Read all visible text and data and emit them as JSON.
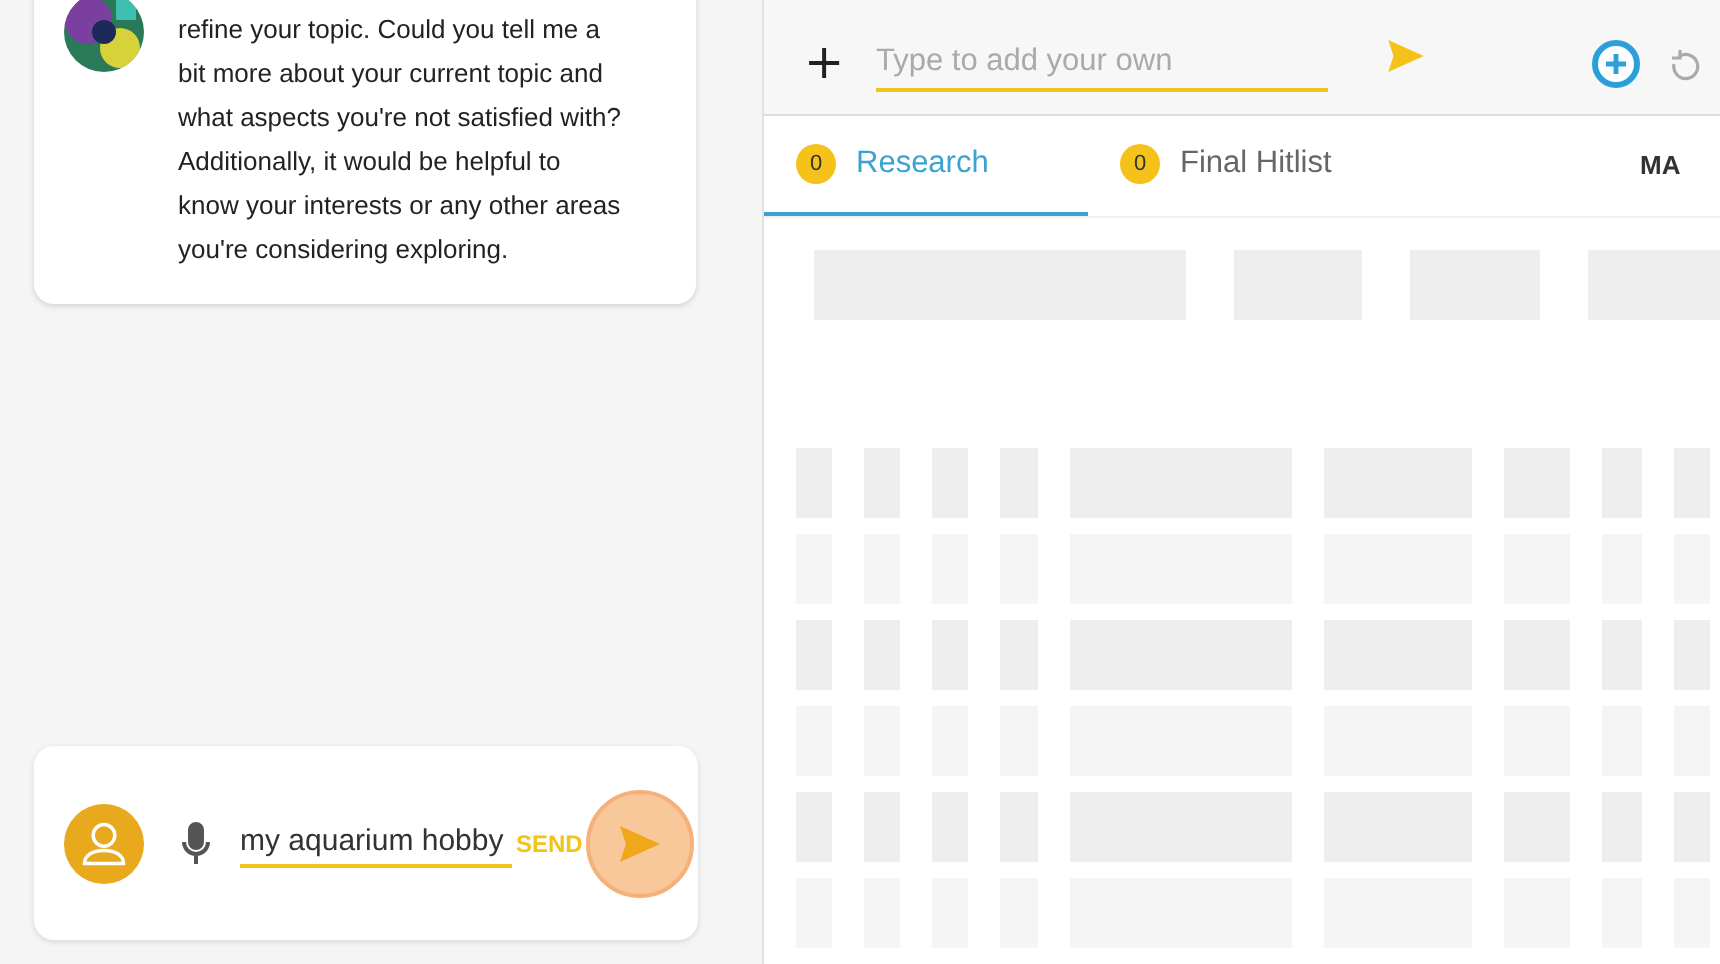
{
  "chat": {
    "message": "refine your topic. Could you tell me a bit more about your current topic and what aspects you're not satisfied with? Additionally, it would be helpful to know your interests or any other areas you're considering exploring.",
    "composer": {
      "value": "my aquarium hobby",
      "send_label": "SEND"
    }
  },
  "add_bar": {
    "plus": "+",
    "placeholder": "Type to add your own"
  },
  "tabs": [
    {
      "label": "Research",
      "count": "0",
      "selected": true
    },
    {
      "label": "Final Hitlist",
      "count": "0",
      "selected": false
    },
    {
      "label": "MA",
      "selected": false
    }
  ]
}
